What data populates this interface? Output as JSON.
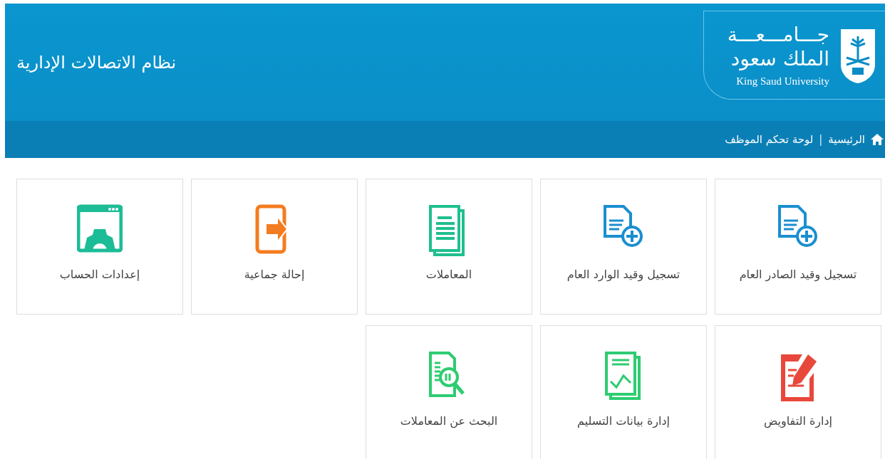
{
  "header": {
    "title": "نظام الاتصالات الإدارية",
    "logo": {
      "arabic_line_1": "جـــامـــعـــة",
      "arabic_line_2": "الملك سعود",
      "english": "King Saud University"
    }
  },
  "breadcrumb": {
    "items": [
      "الرئيسية",
      "لوحة تحكم الموظف"
    ],
    "separator": "|"
  },
  "tiles": [
    {
      "label": "تسجيل وقيد الصادر العام",
      "kind": "docplus",
      "color": "#1a8fd0"
    },
    {
      "label": "تسجيل وقيد الوارد العام",
      "kind": "docplus",
      "color": "#1a8fd0"
    },
    {
      "label": "المعاملات",
      "kind": "docs",
      "color": "#1fbf8f"
    },
    {
      "label": "إحالة جماعية",
      "kind": "exit",
      "color": "#f47c20"
    },
    {
      "label": "إعدادات الحساب",
      "kind": "settings",
      "color": "#1bbc96"
    },
    {
      "label": "إدارة التفاويض",
      "kind": "pen",
      "color": "#e8483b"
    },
    {
      "label": "إدارة بيانات التسليم",
      "kind": "chart",
      "color": "#2ecc71"
    },
    {
      "label": "البحث عن المعاملات",
      "kind": "search",
      "color": "#2ecc71"
    }
  ]
}
